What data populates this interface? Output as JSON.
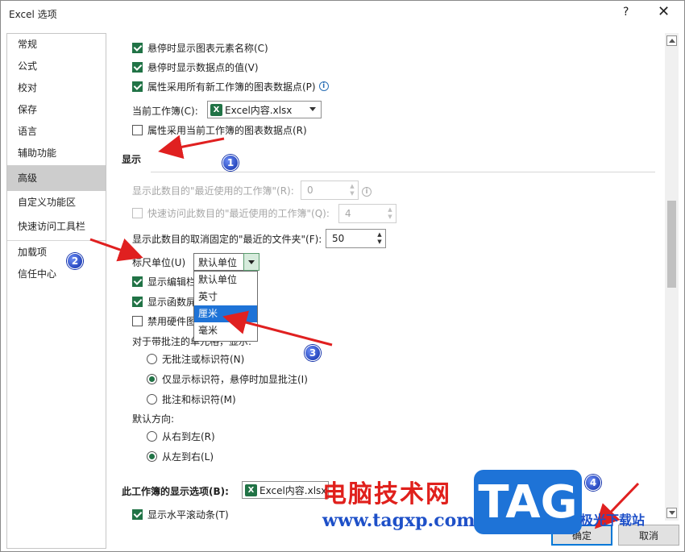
{
  "window": {
    "title": "Excel 选项",
    "help": "?",
    "close": "✕"
  },
  "sidebar": {
    "items": [
      {
        "label": "常规"
      },
      {
        "label": "公式"
      },
      {
        "label": "校对"
      },
      {
        "label": "保存"
      },
      {
        "label": "语言"
      },
      {
        "label": "辅助功能"
      },
      {
        "label": "高级"
      },
      {
        "label": "自定义功能区"
      },
      {
        "label": "快速访问工具栏"
      },
      {
        "label": "加载项"
      },
      {
        "label": "信任中心"
      }
    ],
    "selected": "高级"
  },
  "chart_section": {
    "opt1": "悬停时显示图表元素名称(C)",
    "opt2": "悬停时显示数据点的值(V)",
    "opt3": "属性采用所有新工作簿的图表数据点(P)",
    "workbook_label": "当前工作簿(C):",
    "workbook_value": "Excel内容.xlsx",
    "opt4": "属性采用当前工作簿的图表数据点(R)"
  },
  "display_section": {
    "title": "显示",
    "recent_workbooks_label": "显示此数目的\"最近使用的工作簿\"(R):",
    "recent_workbooks_value": "0",
    "quick_access_label": "快速访问此数目的\"最近使用的工作簿\"(Q):",
    "quick_access_value": "4",
    "unpinned_folders_label": "显示此数目的取消固定的\"最近的文件夹\"(F):",
    "unpinned_folders_value": "50",
    "ruler_units_label": "标尺单位(U)",
    "ruler_units_value": "默认单位",
    "ruler_units_options": [
      "默认单位",
      "英寸",
      "厘米",
      "毫米"
    ],
    "ruler_units_highlighted": "厘米",
    "show_formula_bar": "显示编辑栏",
    "show_function_tips": "显示函数屏",
    "disable_hw": "禁用硬件图",
    "comments_label": "对于带批注的单元格，显示:",
    "comments_none": "无批注或标识符(N)",
    "comments_indicator": "仅显示标识符，悬停时加显批注(I)",
    "comments_both": "批注和标识符(M)",
    "direction_label": "默认方向:",
    "direction_rtl": "从右到左(R)",
    "direction_ltr": "从左到右(L)"
  },
  "workbook_display": {
    "title": "此工作簿的显示选项(B):",
    "workbook_value": "Excel内容.xlsx",
    "show_hscroll": "显示水平滚动条(T)"
  },
  "footer": {
    "ok": "确定",
    "cancel": "取消"
  },
  "annotations": {
    "b1": "1",
    "b2": "2",
    "b3": "3",
    "b4": "4"
  },
  "watermark": {
    "site_name": "电脑技术网",
    "url": "www.tagxp.com",
    "tag": "TAG",
    "sub": "极光下载站"
  },
  "icons": {
    "excel_file": "X",
    "info": "i",
    "spin_up": "▲",
    "spin_down": "▼"
  }
}
